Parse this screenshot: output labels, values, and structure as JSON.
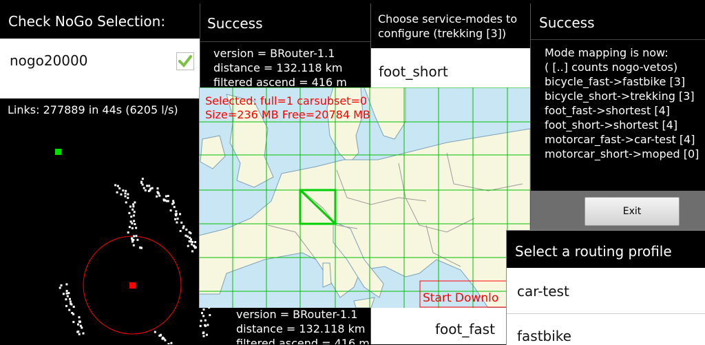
{
  "nogo_dialog": {
    "title": "Check NoGo Selection:",
    "item_label": "nogo20000",
    "checked": true
  },
  "links_view": {
    "status": "Links: 277889 in 44s (6205 l/s)"
  },
  "success_top": {
    "title": "Success",
    "lines": [
      "version = BRouter-1.1",
      "distance = 132.118 km",
      "filtered ascend = 416 m"
    ]
  },
  "success_bottom": {
    "lines": [
      "version = BRouter-1.1",
      "distance = 132.118 km",
      "filtered ascend = 416 m"
    ]
  },
  "service_modes": {
    "title": "Choose service-modes to configure (trekking [3])",
    "items": [
      "foot_short",
      "foot_fast"
    ]
  },
  "mode_mapping": {
    "title": "Success",
    "lines": [
      "Mode mapping is now:",
      "( [..] counts nogo-vetos)",
      "bicycle_fast->fastbike [3]",
      "bicycle_short->trekking [3]",
      "foot_fast->shortest [4]",
      "foot_short->shortest [4]",
      "motorcar_fast->car-test [4]",
      "motorcar_short->moped [0]"
    ],
    "exit_label": "Exit"
  },
  "map_view": {
    "selected_line": "Selected: full=1 carsubset=0",
    "size_line": "Size=236 MB Free=20784 MB",
    "download_label": "Start Downlo",
    "colors": {
      "sea": "#c9e6f5",
      "land": "#f7f7df",
      "grid": "#00c000",
      "label": "#ff0000"
    }
  },
  "routing_profile": {
    "title": "Select a routing profile",
    "items": [
      "car-test",
      "fastbike"
    ]
  }
}
